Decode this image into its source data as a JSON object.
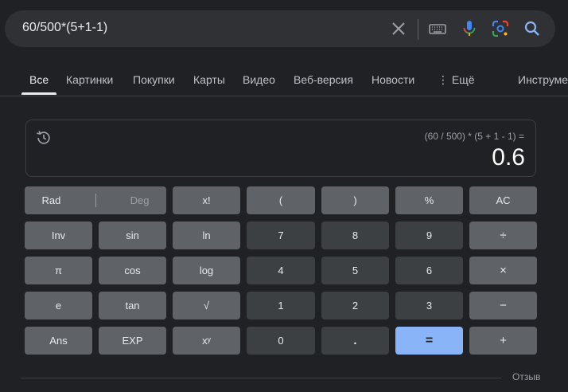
{
  "search": {
    "query": "60/500*(5+1-1)"
  },
  "colors": {
    "background": "#202124",
    "function_key": "#5f6368",
    "number_key": "#3c4043",
    "equals_key": "#8ab4f8",
    "accent_blue": "#4285f4",
    "accent_red": "#ea4335",
    "accent_yellow": "#fbbc04",
    "accent_green": "#34a853"
  },
  "tabs": [
    "Все",
    "Картинки",
    "Покупки",
    "Карты",
    "Видео",
    "Веб-версия",
    "Новости",
    "⋮ Ещё",
    "Инструменты"
  ],
  "calculator": {
    "expression": "(60 / 500) * (5 + 1 - 1) =",
    "result": "0.6",
    "keys": {
      "rad": "Rad",
      "deg": "Deg",
      "factorial": "x!",
      "paren_open": "(",
      "paren_close": ")",
      "percent": "%",
      "clear": "AC",
      "inv": "Inv",
      "sin": "sin",
      "ln": "ln",
      "n7": "7",
      "n8": "8",
      "n9": "9",
      "divide": "÷",
      "pi": "π",
      "cos": "cos",
      "log": "log",
      "n4": "4",
      "n5": "5",
      "n6": "6",
      "multiply": "×",
      "e": "e",
      "tan": "tan",
      "sqrt": "√",
      "n1": "1",
      "n2": "2",
      "n3": "3",
      "minus": "−",
      "ans": "Ans",
      "exp": "EXP",
      "power": "xʸ",
      "n0": "0",
      "dot": ".",
      "equals": "=",
      "plus": "+"
    }
  },
  "footer": {
    "feedback": "Отзыв"
  }
}
